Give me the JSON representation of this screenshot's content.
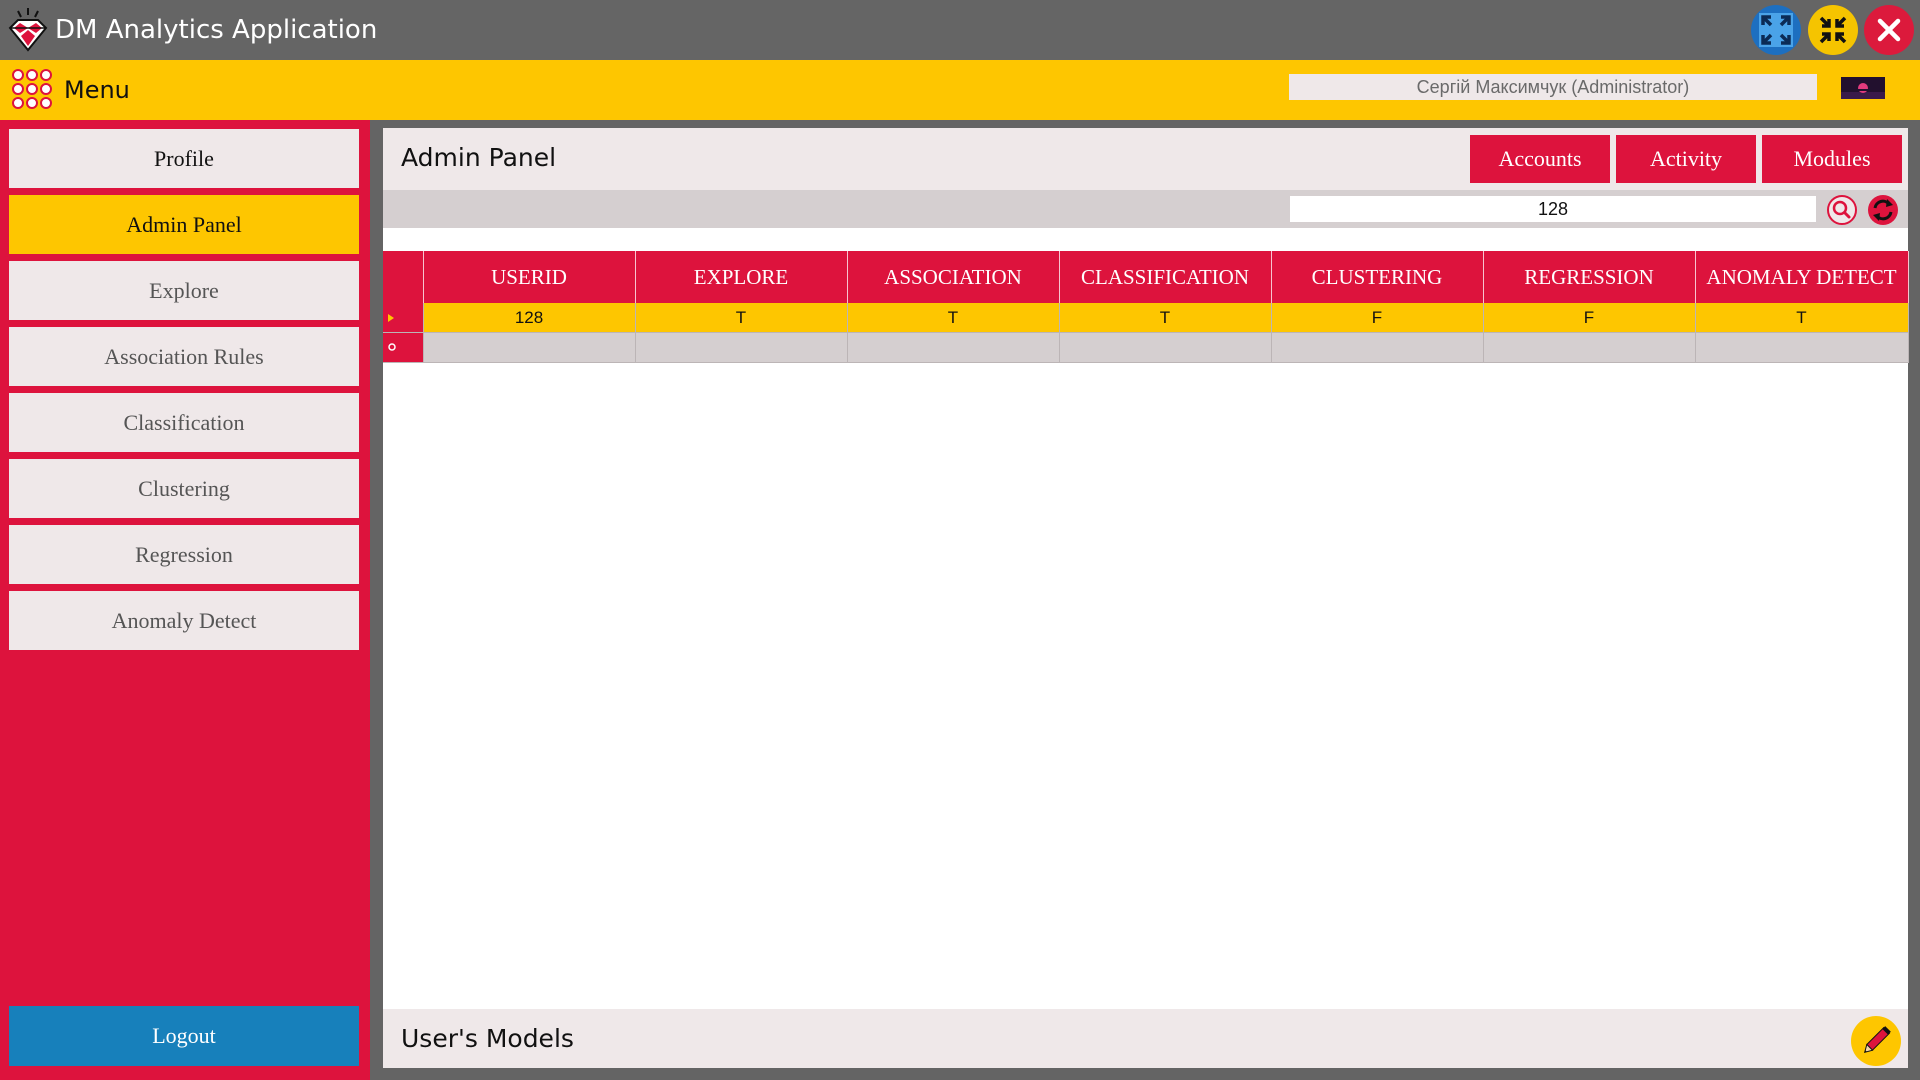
{
  "window": {
    "title": "DM Analytics Application",
    "controls": [
      "maximize-icon",
      "minimize-icon",
      "close-icon"
    ]
  },
  "menubar": {
    "menu_label": "Menu",
    "user": "Сергій Максимчук (Administrator)"
  },
  "sidebar": {
    "items": [
      {
        "label": "Profile",
        "active": false
      },
      {
        "label": "Admin Panel",
        "active": true
      },
      {
        "label": "Explore",
        "active": false
      },
      {
        "label": "Association Rules",
        "active": false
      },
      {
        "label": "Classification",
        "active": false
      },
      {
        "label": "Clustering",
        "active": false
      },
      {
        "label": "Regression",
        "active": false
      },
      {
        "label": "Anomaly Detect",
        "active": false
      }
    ],
    "logout": "Logout"
  },
  "main": {
    "title": "Admin Panel",
    "tabs": [
      {
        "label": "Accounts"
      },
      {
        "label": "Activity"
      },
      {
        "label": "Modules"
      }
    ],
    "search": {
      "value": "128"
    },
    "table": {
      "columns": [
        "USERID",
        "EXPLORE",
        "ASSOCIATION",
        "CLASSIFICATION",
        "CLUSTERING",
        "REGRESSION",
        "ANOMALY DETECT"
      ],
      "rows": [
        [
          "128",
          "T",
          "T",
          "T",
          "F",
          "F",
          "T"
        ]
      ]
    },
    "models_title": "User's Models"
  },
  "colors": {
    "accent_red": "#dd133d",
    "accent_yellow": "#fec600",
    "logout_blue": "#1780bb",
    "panel_bg": "#efe8e9"
  }
}
